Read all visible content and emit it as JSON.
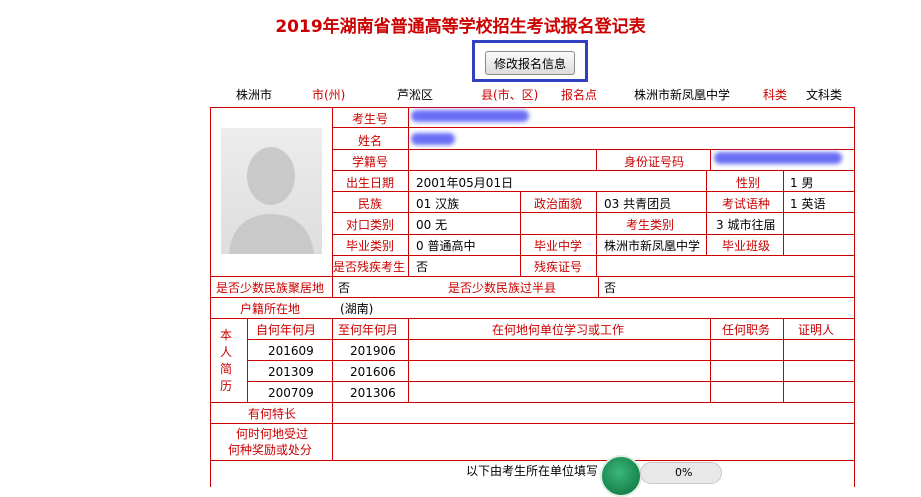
{
  "title": "2019年湖南省普通高等学校招生考试报名登记表",
  "edit_button": "修改报名信息",
  "top_info": {
    "city": "株洲市",
    "city_label": "市(州)",
    "county": "芦淞区",
    "county_label": "县(市、区)",
    "site_label": "报名点",
    "site": "株洲市新凤凰中学",
    "subject_label": "科类",
    "subject": "文科类"
  },
  "labels": {
    "exam_no": "考生号",
    "name": "姓名",
    "student_no": "学籍号",
    "id_no": "身份证号码",
    "birth": "出生日期",
    "gender": "性别",
    "ethnic": "民族",
    "political": "政治面貌",
    "language": "考试语种",
    "counterpart": "对口类别",
    "candidate_type": "考生类别",
    "grad_type": "毕业类别",
    "grad_school": "毕业中学",
    "grad_class": "毕业班级",
    "disabled": "是否残疾考生",
    "disability_no": "残疾证号",
    "minority_area": "是否少数民族聚居地",
    "minority_half": "是否少数民族过半县",
    "household": "户籍所在地",
    "resume_1": "本",
    "resume_2": "人",
    "resume_3": "简",
    "resume_4": "历",
    "from": "自何年何月",
    "to": "至何年何月",
    "where": "在何地何单位学习或工作",
    "position": "任何职务",
    "witness": "证明人",
    "specialty": "有何特长",
    "awards_1": "何时何地受过",
    "awards_2": "何种奖励或处分",
    "footer_note": "以下由考生所在单位填写"
  },
  "values": {
    "birth": "2001年05月01日",
    "gender": "1 男",
    "ethnic": "01 汉族",
    "political": "03 共青团员",
    "language": "1 英语",
    "counterpart": "00 无",
    "candidate_type": "3 城市往届",
    "grad_type": "0 普通高中",
    "grad_school": "株洲市新凤凰中学",
    "disabled": "否",
    "minority_area": "否",
    "minority_half": "否",
    "household": "(湖南)"
  },
  "resume": [
    {
      "from": "201609",
      "to": "201906"
    },
    {
      "from": "201309",
      "to": "201606"
    },
    {
      "from": "200709",
      "to": "201306"
    }
  ],
  "progress_text": "0%",
  "colors": {
    "label_red": "#cc0000",
    "highlight_blue": "#3040c0",
    "blur_blue": "#5a5ef0"
  }
}
